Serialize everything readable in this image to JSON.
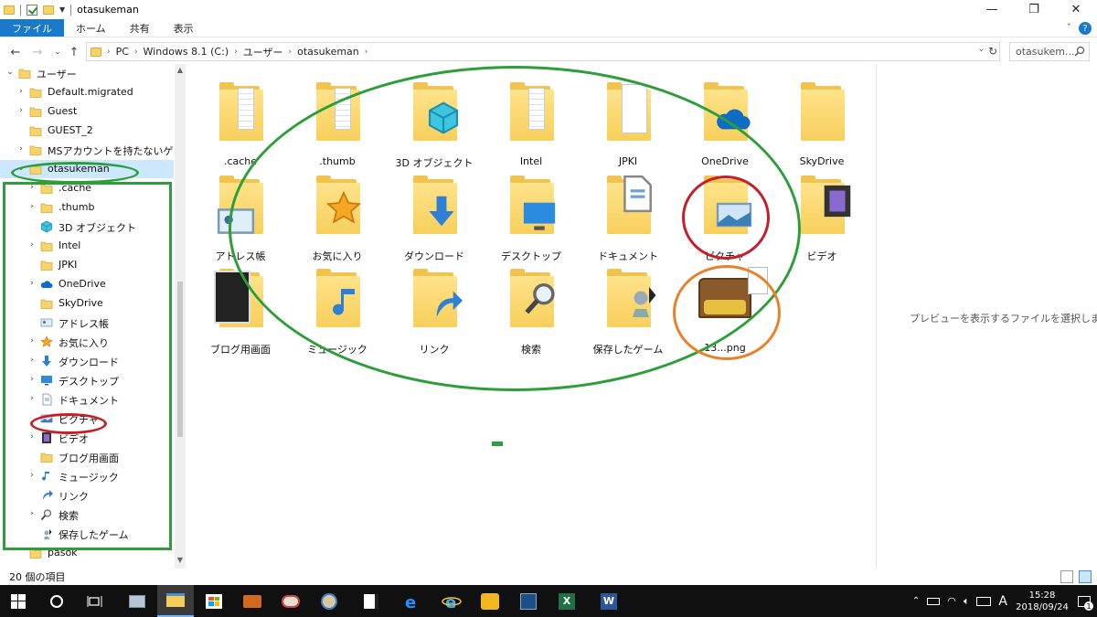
{
  "window": {
    "title": "otasukeman",
    "controls": {
      "minimize": "—",
      "maximize": "❐",
      "close": "✕"
    }
  },
  "ribbon": {
    "tabs": [
      "ファイル",
      "ホーム",
      "共有",
      "表示"
    ],
    "expand": "ˇ",
    "help": "?"
  },
  "address": {
    "crumbs": [
      "PC",
      "Windows 8.1 (C:)",
      "ユーザー",
      "otasukeman"
    ],
    "search_placeholder": "otasukem..."
  },
  "nav": {
    "items": [
      {
        "label": "ユーザー",
        "expanded": true,
        "level": 1,
        "icon": "folder"
      },
      {
        "label": "Default.migrated",
        "level": 2,
        "icon": "folder"
      },
      {
        "label": "Guest",
        "level": 2,
        "icon": "folder"
      },
      {
        "label": "GUEST_2",
        "level": 2,
        "icon": "folder",
        "no_chevron": true
      },
      {
        "label": "MSアカウントを持たないゲスト",
        "level": 2,
        "icon": "folder"
      },
      {
        "label": "otasukeman",
        "level": 2,
        "icon": "folder",
        "expanded": true,
        "selected": true
      },
      {
        "label": ".cache",
        "level": 3,
        "icon": "folder"
      },
      {
        "label": ".thumb",
        "level": 3,
        "icon": "folder"
      },
      {
        "label": "3D オブジェクト",
        "level": 3,
        "icon": "cube",
        "no_chevron": true
      },
      {
        "label": "Intel",
        "level": 3,
        "icon": "folder"
      },
      {
        "label": "JPKI",
        "level": 3,
        "icon": "folder",
        "no_chevron": true
      },
      {
        "label": "OneDrive",
        "level": 3,
        "icon": "cloud"
      },
      {
        "label": "SkyDrive",
        "level": 3,
        "icon": "folder",
        "no_chevron": true
      },
      {
        "label": "アドレス帳",
        "level": 3,
        "icon": "contact",
        "no_chevron": true
      },
      {
        "label": "お気に入り",
        "level": 3,
        "icon": "star"
      },
      {
        "label": "ダウンロード",
        "level": 3,
        "icon": "download"
      },
      {
        "label": "デスクトップ",
        "level": 3,
        "icon": "desktop"
      },
      {
        "label": "ドキュメント",
        "level": 3,
        "icon": "document"
      },
      {
        "label": "ピクチャ",
        "level": 3,
        "icon": "picture",
        "no_chevron": true
      },
      {
        "label": "ビデオ",
        "level": 3,
        "icon": "video"
      },
      {
        "label": "ブログ用画面",
        "level": 3,
        "icon": "folder",
        "no_chevron": true
      },
      {
        "label": "ミュージック",
        "level": 3,
        "icon": "music"
      },
      {
        "label": "リンク",
        "level": 3,
        "icon": "link",
        "no_chevron": true
      },
      {
        "label": "検索",
        "level": 3,
        "icon": "search"
      },
      {
        "label": "保存したゲーム",
        "level": 3,
        "icon": "game",
        "no_chevron": true
      },
      {
        "label": "pasok",
        "level": 2,
        "icon": "folder",
        "no_chevron": true
      }
    ]
  },
  "content": {
    "items": [
      {
        "label": ".cache",
        "icon": "folder-papers"
      },
      {
        "label": ".thumb",
        "icon": "folder-papers"
      },
      {
        "label": "3D オブジェクト",
        "icon": "cube"
      },
      {
        "label": "Intel",
        "icon": "folder-papers"
      },
      {
        "label": "JPKI",
        "icon": "folder-blank"
      },
      {
        "label": "OneDrive",
        "icon": "cloud"
      },
      {
        "label": "SkyDrive",
        "icon": "folder"
      },
      {
        "label": "アドレス帳",
        "icon": "contact"
      },
      {
        "label": "お気に入り",
        "icon": "star"
      },
      {
        "label": "ダウンロード",
        "icon": "download"
      },
      {
        "label": "デスクトップ",
        "icon": "desktop"
      },
      {
        "label": "ドキュメント",
        "icon": "document"
      },
      {
        "label": "ピクチャ",
        "icon": "picture"
      },
      {
        "label": "ビデオ",
        "icon": "video"
      },
      {
        "label": "ブログ用画面",
        "icon": "screenshot"
      },
      {
        "label": "ミュージック",
        "icon": "music"
      },
      {
        "label": "リンク",
        "icon": "link"
      },
      {
        "label": "検索",
        "icon": "search"
      },
      {
        "label": "保存したゲーム",
        "icon": "game"
      },
      {
        "label": "13...png",
        "icon": "treasure"
      }
    ]
  },
  "preview": {
    "text": "プレビューを表示するファイルを選択します。"
  },
  "status": {
    "count": "20 個の項目"
  },
  "taskbar": {
    "clock_time": "15:28",
    "clock_date": "2018/09/24",
    "ime": "A",
    "notification_count": "1"
  },
  "annotation_colors": {
    "green": "#2e9e3a",
    "red": "#c4202a",
    "orange": "#e8822a"
  }
}
